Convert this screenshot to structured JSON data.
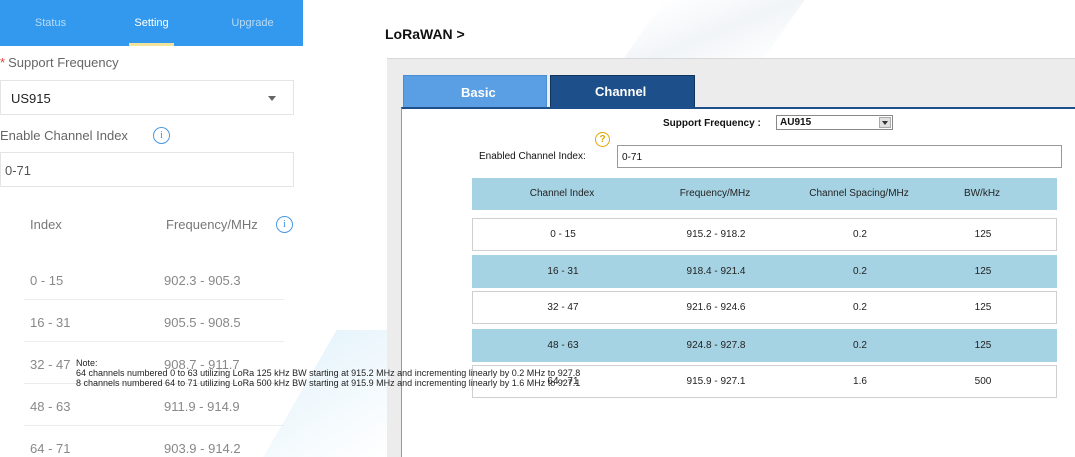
{
  "mobile": {
    "tabs": [
      "Status",
      "Setting",
      "Upgrade"
    ],
    "support_frequency_label": "Support Frequency",
    "support_frequency_value": "US915",
    "enable_channel_label": "Enable Channel Index",
    "enable_channel_value": "0-71",
    "table_headers": [
      "Index",
      "Frequency/MHz"
    ],
    "rows": [
      {
        "index": "0 - 15",
        "freq": "902.3 - 905.3"
      },
      {
        "index": "16 - 31",
        "freq": "905.5 - 908.5"
      },
      {
        "index": "32 - 47",
        "freq": "908.7 - 911.7"
      },
      {
        "index": "48 - 63",
        "freq": "911.9 - 914.9"
      },
      {
        "index": "64 - 71",
        "freq": "903.9 - 914.2"
      }
    ]
  },
  "desktop": {
    "title": "LoRaWAN >",
    "tabs": [
      "Basic",
      "Channel"
    ],
    "support_frequency_label": "Support Frequency :",
    "support_frequency_value": "AU915",
    "enabled_channel_label": "Enabled Channel Index:",
    "enabled_channel_value": "0-71",
    "table_headers": [
      "Channel Index",
      "Frequency/MHz",
      "Channel Spacing/MHz",
      "BW/kHz"
    ],
    "rows": [
      {
        "index": "0 - 15",
        "freq": "915.2 - 918.2",
        "spacing": "0.2",
        "bw": "125"
      },
      {
        "index": "16 - 31",
        "freq": "918.4 - 921.4",
        "spacing": "0.2",
        "bw": "125"
      },
      {
        "index": "32 - 47",
        "freq": "921.6 - 924.6",
        "spacing": "0.2",
        "bw": "125"
      },
      {
        "index": "48 - 63",
        "freq": "924.8 - 927.8",
        "spacing": "0.2",
        "bw": "125"
      },
      {
        "index": "64 - 71",
        "freq": "915.9 - 927.1",
        "spacing": "1.6",
        "bw": "500"
      }
    ],
    "note_title": "Note:",
    "note_lines": [
      "64 channels numbered 0 to 63 utilizing LoRa 125 kHz BW starting at 915.2 MHz and incrementing linearly by 0.2 MHz to 927.8",
      "8 channels numbered 64 to 71 utilizing LoRa 500 kHz BW starting at 915.9 MHz and incrementing linearly by 1.6 MHz to 927.1"
    ]
  },
  "icons": {
    "info": "i",
    "help": "?"
  }
}
